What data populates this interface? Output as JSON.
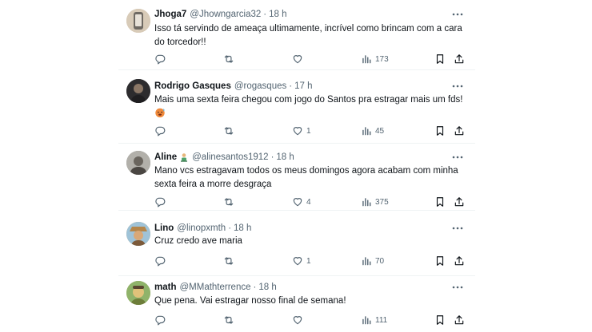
{
  "tweets": [
    {
      "name": "Jhoga7",
      "handle": "@Jhowngarcia32",
      "sep": "·",
      "time": "18 h",
      "text": "Isso tá servindo de ameaça ultimamente, incrível como brincam com a cara do torcedor!!",
      "likes": "",
      "views": "173",
      "avatar_color": "#c9b8a3"
    },
    {
      "name": "Rodrigo Gasques",
      "handle": "@rogasques",
      "sep": "·",
      "time": "17 h",
      "text": "Mais uma sexta feira chegou com jogo do Santos pra estragar mais um fds!",
      "emoji": "hot-face-emoji",
      "likes": "1",
      "views": "45",
      "avatar_color": "#3b3a3c"
    },
    {
      "name": "Aline",
      "handle": "@alinesantos1912",
      "sep": "·",
      "time": "18 h",
      "text": "Mano vcs estragavam todos os  meus domingos agora acabam com minha sexta feira a morre desgraça",
      "badge": "person-emoji-badge",
      "likes": "4",
      "views": "375",
      "avatar_color": "#8a8a84"
    },
    {
      "name": "Lino",
      "handle": "@linopxmth",
      "sep": "·",
      "time": "18 h",
      "text": "Cruz credo ave maria",
      "likes": "1",
      "views": "70",
      "avatar_color": "#c79a5d"
    },
    {
      "name": "math",
      "handle": "@MMathterrence",
      "sep": "·",
      "time": "18 h",
      "text": "Que pena. Vai estragar nosso final de semana!",
      "likes": "",
      "views": "111",
      "avatar_color": "#b9a05e"
    }
  ],
  "colors": {
    "text": "#0f1419",
    "secondary": "#536471",
    "divider": "#eff3f4"
  }
}
